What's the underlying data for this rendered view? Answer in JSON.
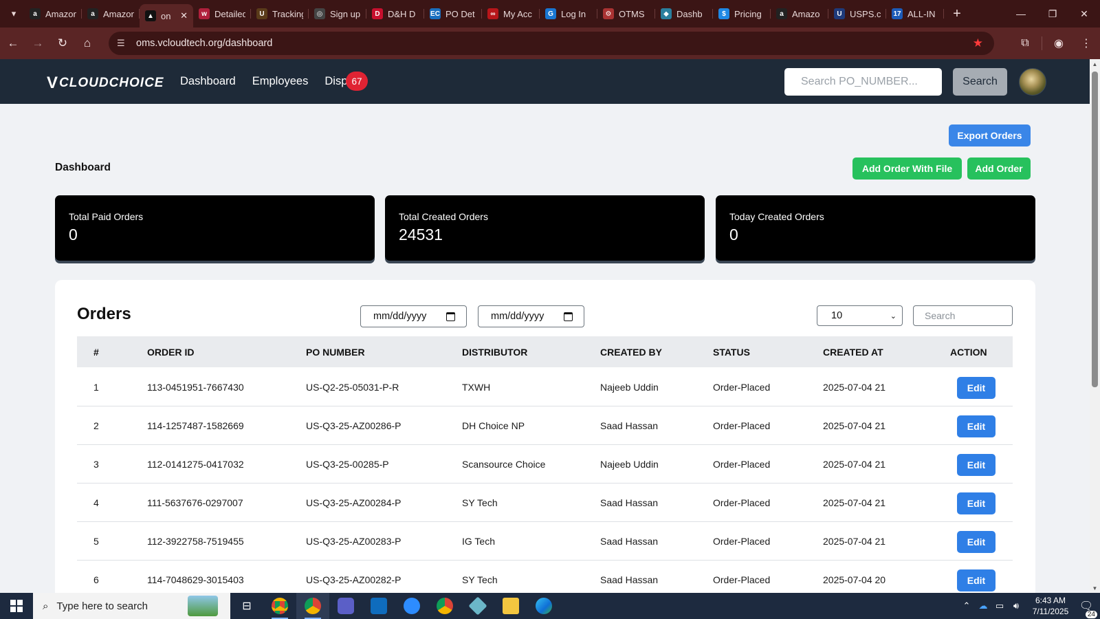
{
  "browser": {
    "tabs": [
      {
        "label": "Amazon",
        "fav_color": "#222",
        "fav_glyph": "a"
      },
      {
        "label": "Amazon",
        "fav_color": "#222",
        "fav_glyph": "a"
      },
      {
        "label": "on",
        "fav_color": "#111",
        "fav_glyph": "▲",
        "active": true
      },
      {
        "label": "Detailed",
        "fav_color": "#b0203c",
        "fav_glyph": "w"
      },
      {
        "label": "Tracking",
        "fav_color": "#5a3b1a",
        "fav_glyph": "U"
      },
      {
        "label": "Sign up",
        "fav_color": "#444",
        "fav_glyph": "◎"
      },
      {
        "label": "D&H D",
        "fav_color": "#c8102e",
        "fav_glyph": "D"
      },
      {
        "label": "PO Det",
        "fav_color": "#1a6fbf",
        "fav_glyph": "EC"
      },
      {
        "label": "My Acc",
        "fav_color": "#b8161a",
        "fav_glyph": "∞"
      },
      {
        "label": "Log In",
        "fav_color": "#1976d2",
        "fav_glyph": "G"
      },
      {
        "label": "OTMS",
        "fav_color": "#a33",
        "fav_glyph": "⚙"
      },
      {
        "label": "Dashb",
        "fav_color": "#2a7f9e",
        "fav_glyph": "◆"
      },
      {
        "label": "Pricing",
        "fav_color": "#1e88e5",
        "fav_glyph": "$"
      },
      {
        "label": "Amazo",
        "fav_color": "#222",
        "fav_glyph": "a"
      },
      {
        "label": "USPS.c",
        "fav_color": "#1f3a7a",
        "fav_glyph": "U"
      },
      {
        "label": "ALL-IN",
        "fav_color": "#1c5bb8",
        "fav_glyph": "17"
      }
    ],
    "url": "oms.vcloudtech.org/dashboard"
  },
  "navbar": {
    "brand": "CLOUDCHOICE",
    "links": [
      "Dashboard",
      "Employees",
      "Dispu"
    ],
    "disputes_count": "67",
    "search_placeholder": "Search PO_NUMBER...",
    "search_button": "Search"
  },
  "page": {
    "title": "Dashboard",
    "export_button": "Export Orders",
    "add_with_file_button": "Add Order With File",
    "add_order_button": "Add Order"
  },
  "stats": [
    {
      "label": "Total Paid Orders",
      "value": "0"
    },
    {
      "label": "Total Created Orders",
      "value": "24531"
    },
    {
      "label": "Today Created Orders",
      "value": "0"
    }
  ],
  "orders": {
    "title": "Orders",
    "date_placeholder": "mm/dd/yyyy",
    "page_size": "10",
    "search_placeholder": "Search",
    "columns": [
      "#",
      "ORDER ID",
      "PO NUMBER",
      "DISTRIBUTOR",
      "CREATED BY",
      "STATUS",
      "CREATED AT",
      "ACTION"
    ],
    "edit_label": "Edit",
    "rows": [
      {
        "n": "1",
        "order_id": "113-0451951-7667430",
        "po": "US-Q2-25-05031-P-R",
        "distributor": "TXWH",
        "created_by": "Najeeb Uddin",
        "status": "Order-Placed",
        "created_at": "2025-07-04 21"
      },
      {
        "n": "2",
        "order_id": "114-1257487-1582669",
        "po": "US-Q3-25-AZ00286-P",
        "distributor": "DH Choice NP",
        "created_by": "Saad Hassan",
        "status": "Order-Placed",
        "created_at": "2025-07-04 21"
      },
      {
        "n": "3",
        "order_id": "112-0141275-0417032",
        "po": "US-Q3-25-00285-P",
        "distributor": "Scansource Choice",
        "created_by": "Najeeb Uddin",
        "status": "Order-Placed",
        "created_at": "2025-07-04 21"
      },
      {
        "n": "4",
        "order_id": "111-5637676-0297007",
        "po": "US-Q3-25-AZ00284-P",
        "distributor": "SY Tech",
        "created_by": "Saad Hassan",
        "status": "Order-Placed",
        "created_at": "2025-07-04 21"
      },
      {
        "n": "5",
        "order_id": "112-3922758-7519455",
        "po": "US-Q3-25-AZ00283-P",
        "distributor": "IG Tech",
        "created_by": "Saad Hassan",
        "status": "Order-Placed",
        "created_at": "2025-07-04 21"
      },
      {
        "n": "6",
        "order_id": "114-7048629-3015403",
        "po": "US-Q3-25-AZ00282-P",
        "distributor": "SY Tech",
        "created_by": "Saad Hassan",
        "status": "Order-Placed",
        "created_at": "2025-07-04 20"
      }
    ]
  },
  "taskbar": {
    "search_placeholder": "Type here to search",
    "time": "6:43 AM",
    "date": "7/11/2025",
    "notifications": "24"
  }
}
